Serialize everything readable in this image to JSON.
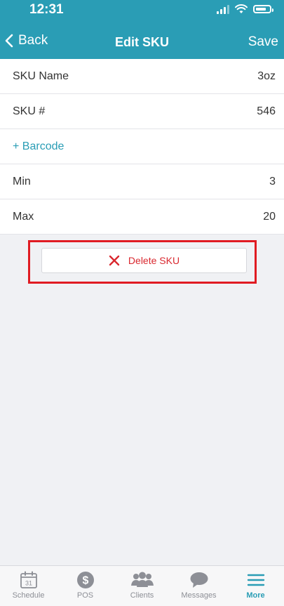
{
  "status": {
    "time": "12:31"
  },
  "nav": {
    "back_label": "Back",
    "title": "Edit SKU",
    "save_label": "Save"
  },
  "fields": {
    "sku_name": {
      "label": "SKU Name",
      "value": "3oz"
    },
    "sku_number": {
      "label": "SKU #",
      "value": "546"
    },
    "barcode": {
      "label": "+ Barcode"
    },
    "min": {
      "label": "Min",
      "value": "3"
    },
    "max": {
      "label": "Max",
      "value": "20"
    }
  },
  "delete_button": {
    "label": "Delete SKU",
    "icon": "close-icon"
  },
  "tabs": [
    {
      "label": "Schedule",
      "icon": "calendar-icon",
      "calendar_day": "31"
    },
    {
      "label": "POS",
      "icon": "dollar-icon"
    },
    {
      "label": "Clients",
      "icon": "people-icon"
    },
    {
      "label": "Messages",
      "icon": "chat-bubble-icon"
    },
    {
      "label": "More",
      "icon": "menu-icon",
      "active": true
    }
  ],
  "colors": {
    "header": "#2a9db5",
    "accent": "#2a9db5",
    "danger": "#d9282f",
    "highlight_box": "#e01b22",
    "background": "#f0f1f4"
  }
}
